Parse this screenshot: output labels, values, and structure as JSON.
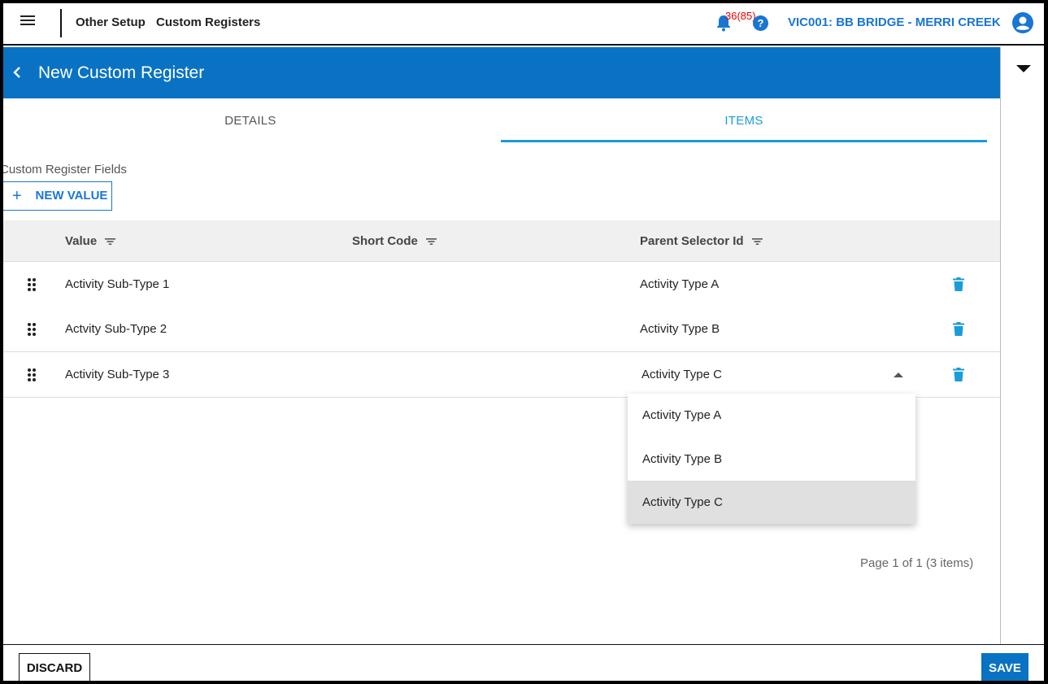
{
  "topbar": {
    "breadcrumb": [
      "Other Setup",
      "Custom Registers"
    ],
    "notification_count": "36(85)",
    "help_label": "?",
    "org": "VIC001: BB BRIDGE - MERRI CREEK"
  },
  "header": {
    "title": "New Custom Register"
  },
  "tabs": [
    {
      "label": "DETAILS",
      "active": false
    },
    {
      "label": "ITEMS",
      "active": true
    }
  ],
  "section": {
    "label": "Custom Register Fields",
    "new_value_label": "NEW VALUE"
  },
  "table": {
    "columns": [
      "Value",
      "Short Code",
      "Parent Selector Id"
    ],
    "rows": [
      {
        "value": "Activity Sub-Type 1",
        "short_code": "",
        "parent": "Activity Type A"
      },
      {
        "value": "Actvity Sub-Type 2",
        "short_code": "",
        "parent": "Activity Type B"
      },
      {
        "value": "Activity Sub-Type 3",
        "short_code": "",
        "parent": "Activity Type C"
      }
    ]
  },
  "dropdown": {
    "options": [
      "Activity Type A",
      "Activity Type B",
      "Activity Type C"
    ],
    "selected": "Activity Type C"
  },
  "pager": {
    "text": "Page 1 of 1 (3 items)"
  },
  "footer": {
    "discard_label": "DISCARD",
    "save_label": "SAVE"
  },
  "colors": {
    "primary": "#0a72c2",
    "accent": "#1a9cd8",
    "link": "#1976d2"
  }
}
